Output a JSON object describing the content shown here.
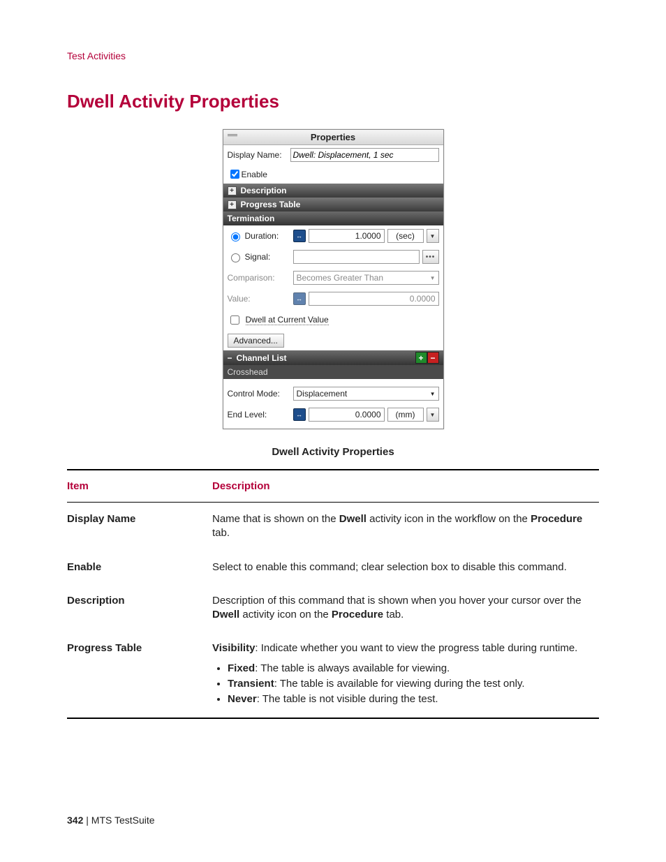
{
  "header": {
    "breadcrumb": "Test Activities"
  },
  "title": "Dwell Activity Properties",
  "panel": {
    "title": "Properties",
    "displayName": {
      "label": "Display Name:",
      "value": "Dwell: Displacement, 1 sec"
    },
    "enable": {
      "label": "Enable",
      "checked": true
    },
    "sections": {
      "description": "Description",
      "progressTable": "Progress Table",
      "termination": "Termination"
    },
    "termination": {
      "duration": {
        "label": "Duration:",
        "value": "1.0000",
        "unit": "(sec)"
      },
      "signal": {
        "label": "Signal:"
      },
      "comparison": {
        "label": "Comparison:",
        "value": "Becomes Greater Than"
      },
      "value": {
        "label": "Value:",
        "value": "0.0000"
      }
    },
    "dwellAtCurrent": {
      "label": "Dwell at Current Value",
      "checked": false
    },
    "advanced": "Advanced...",
    "channelList": {
      "title": "Channel List",
      "items": [
        "Crosshead"
      ]
    },
    "controlMode": {
      "label": "Control Mode:",
      "value": "Displacement"
    },
    "endLevel": {
      "label": "End Level:",
      "value": "0.0000",
      "unit": "(mm)"
    }
  },
  "caption": "Dwell Activity Properties",
  "table": {
    "headers": {
      "item": "Item",
      "desc": "Description"
    },
    "rows": {
      "displayName": {
        "item": "Display Name",
        "desc_pre": "Name that is shown on the ",
        "bold1": "Dwell",
        "desc_mid": " activity icon in the workflow on the ",
        "bold2": "Procedure",
        "desc_post": " tab."
      },
      "enable": {
        "item": "Enable",
        "desc": "Select to enable this command; clear selection box to disable this command."
      },
      "description": {
        "item": "Description",
        "desc_pre": "Description of this command that is shown when you hover your cursor over the ",
        "bold1": "Dwell",
        "desc_mid": " activity icon on the ",
        "bold2": "Procedure",
        "desc_post": " tab."
      },
      "progressTable": {
        "item": "Progress Table",
        "lead_bold": "Visibility",
        "lead_rest": ": Indicate whether you want to view the progress table during runtime.",
        "bullets": [
          {
            "b": "Fixed",
            "rest": ": The table is always available for viewing."
          },
          {
            "b": "Transient",
            "rest": ": The table is available for viewing during the test only."
          },
          {
            "b": "Never",
            "rest": ": The table is not visible during the test."
          }
        ]
      }
    }
  },
  "footer": {
    "page": "342",
    "sep": " | ",
    "product": "MTS TestSuite"
  }
}
